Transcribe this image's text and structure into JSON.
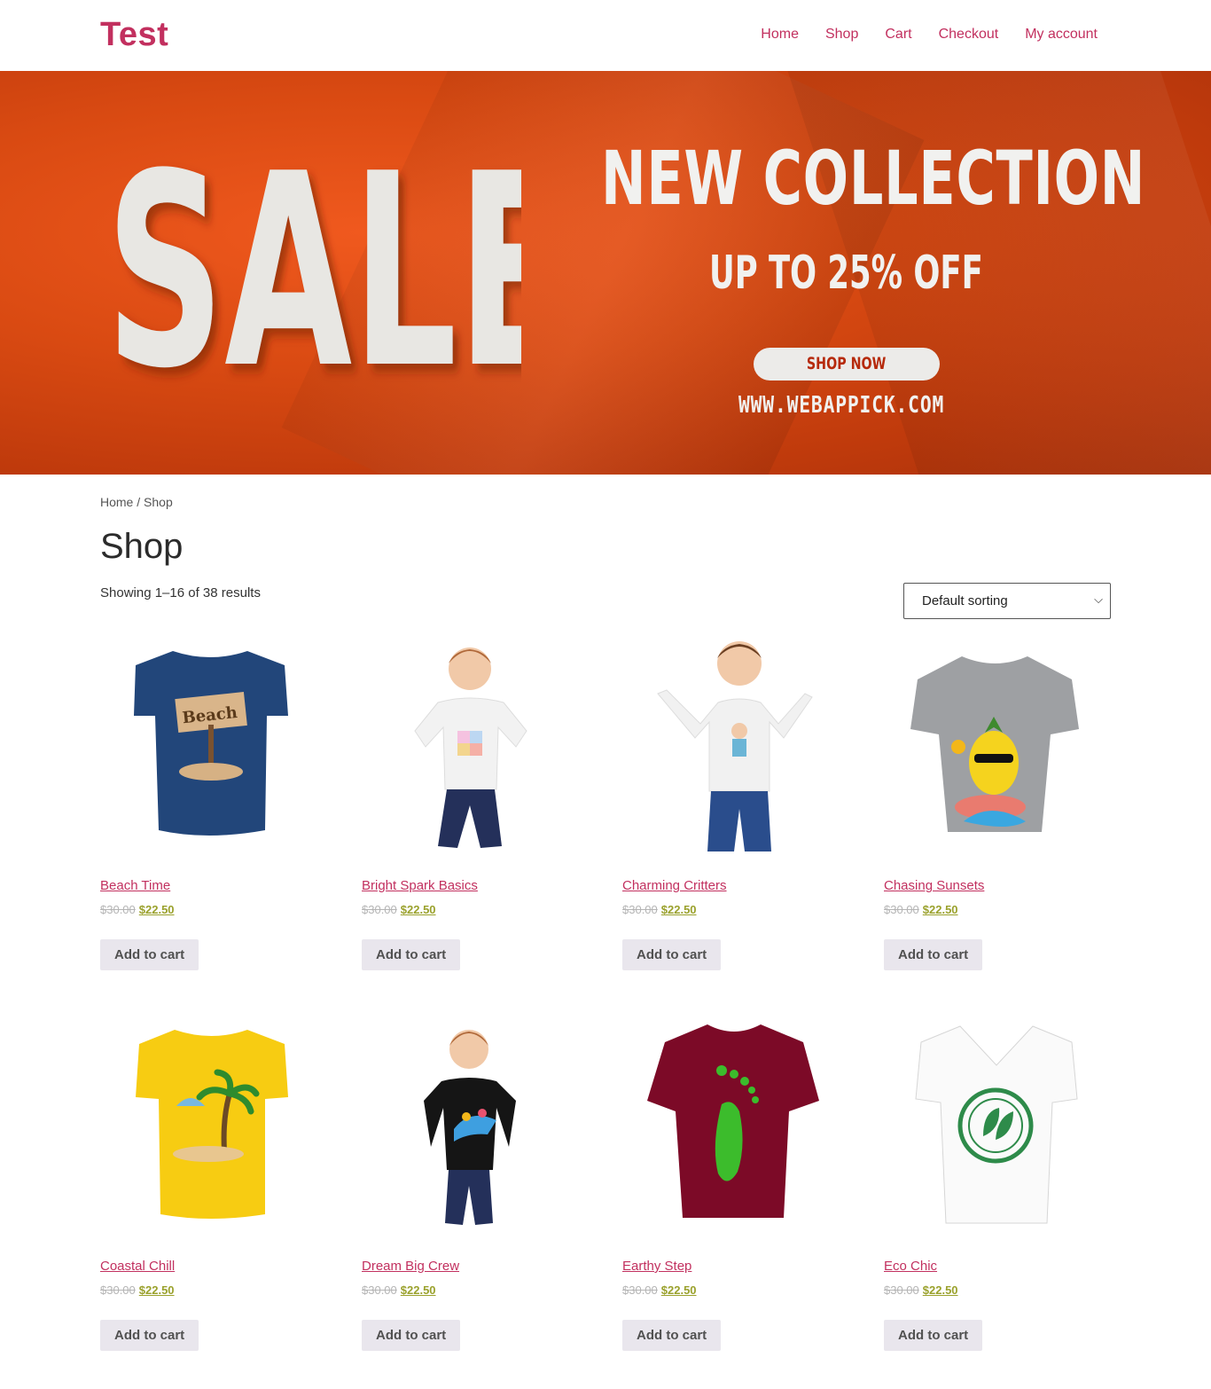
{
  "site": {
    "title": "Test"
  },
  "nav": [
    "Home",
    "Shop",
    "Cart",
    "Checkout",
    "My account"
  ],
  "banner": {
    "big_word": "SALE",
    "headline": "NEW  COLLECTION",
    "subline": "UP TO 25% OFF",
    "button": "SHOP NOW",
    "url": "WWW.WEBAPPICK.COM"
  },
  "breadcrumb": {
    "home": "Home",
    "separator": " / ",
    "current": "Shop"
  },
  "page_title": "Shop",
  "result_count": "Showing 1–16 of 38 results",
  "orderby": {
    "selected": "Default sorting"
  },
  "colors": {
    "brand": "#c2305f",
    "sale_price": "#9aa12c",
    "button_bg": "#e9e6ed",
    "banner_orange": "#d94a12"
  },
  "products": [
    {
      "name": "Beach Time",
      "old_price": "$30.00",
      "price": "$22.50",
      "button": "Add to cart",
      "icon": "navy-tshirt-beach-sign"
    },
    {
      "name": "Bright Spark Basics",
      "old_price": "$30.00",
      "price": "$22.50",
      "button": "Add to cart",
      "icon": "girl-white-tshirt-abc"
    },
    {
      "name": "Charming Critters",
      "old_price": "$30.00",
      "price": "$22.50",
      "button": "Add to cart",
      "icon": "boy-white-tshirt"
    },
    {
      "name": "Chasing Sunsets",
      "old_price": "$30.00",
      "price": "$22.50",
      "button": "Add to cart",
      "icon": "grey-tshirt-pineapple"
    },
    {
      "name": "Coastal Chill",
      "old_price": "$30.00",
      "price": "$22.50",
      "button": "Add to cart",
      "icon": "yellow-tshirt-palm"
    },
    {
      "name": "Dream Big Crew",
      "old_price": "$30.00",
      "price": "$22.50",
      "button": "Add to cart",
      "icon": "girl-black-tshirt"
    },
    {
      "name": "Earthy Step",
      "old_price": "$30.00",
      "price": "$22.50",
      "button": "Add to cart",
      "icon": "maroon-tshirt-footprint"
    },
    {
      "name": "Eco Chic",
      "old_price": "$30.00",
      "price": "$22.50",
      "button": "Add to cart",
      "icon": "white-vneck-eco-badge"
    }
  ]
}
